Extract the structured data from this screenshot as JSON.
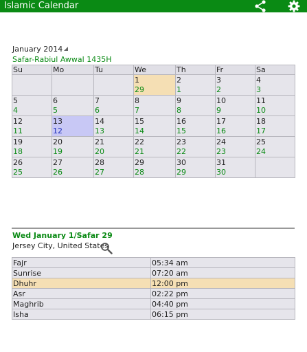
{
  "app": {
    "title": "Islamic Calendar",
    "share_icon": "share-icon",
    "settings_icon": "gear-icon",
    "bar_color": "#0a8a14"
  },
  "calendar": {
    "month_label": "January 2014",
    "hijri_label": "Safar-Rabiul Awwal 1435H",
    "weekdays": [
      "Su",
      "Mo",
      "Tu",
      "We",
      "Th",
      "Fr",
      "Sa"
    ],
    "weeks": [
      [
        null,
        null,
        null,
        {
          "g": "1",
          "h": "29",
          "state": "today"
        },
        {
          "g": "2",
          "h": "1"
        },
        {
          "g": "3",
          "h": "2"
        },
        {
          "g": "4",
          "h": "3"
        }
      ],
      [
        {
          "g": "5",
          "h": "4"
        },
        {
          "g": "6",
          "h": "5"
        },
        {
          "g": "7",
          "h": "6"
        },
        {
          "g": "8",
          "h": "7"
        },
        {
          "g": "9",
          "h": "8"
        },
        {
          "g": "10",
          "h": "9"
        },
        {
          "g": "11",
          "h": "10"
        }
      ],
      [
        {
          "g": "12",
          "h": "11"
        },
        {
          "g": "13",
          "h": "12",
          "state": "selected"
        },
        {
          "g": "14",
          "h": "13"
        },
        {
          "g": "15",
          "h": "14"
        },
        {
          "g": "16",
          "h": "15"
        },
        {
          "g": "17",
          "h": "16"
        },
        {
          "g": "18",
          "h": "17"
        }
      ],
      [
        {
          "g": "19",
          "h": "18"
        },
        {
          "g": "20",
          "h": "19"
        },
        {
          "g": "21",
          "h": "20"
        },
        {
          "g": "22",
          "h": "21"
        },
        {
          "g": "23",
          "h": "22"
        },
        {
          "g": "24",
          "h": "23"
        },
        {
          "g": "25",
          "h": "24"
        }
      ],
      [
        {
          "g": "26",
          "h": "25"
        },
        {
          "g": "27",
          "h": "26"
        },
        {
          "g": "28",
          "h": "27"
        },
        {
          "g": "29",
          "h": "28"
        },
        {
          "g": "30",
          "h": "29"
        },
        {
          "g": "31",
          "h": "30"
        },
        null
      ]
    ],
    "colors": {
      "today": "#f5dfb4",
      "selected": "#c8c8f5",
      "hijri_text": "#0a8a14"
    }
  },
  "details": {
    "selected_date": "Wed January 1/Safar 29",
    "location": "Jersey City, United States",
    "search_icon": "search-icon"
  },
  "prayers": [
    {
      "name": "Fajr",
      "time": "05:34 am"
    },
    {
      "name": "Sunrise",
      "time": "07:20 am"
    },
    {
      "name": "Dhuhr",
      "time": "12:00 pm",
      "current": true
    },
    {
      "name": "Asr",
      "time": "02:22 pm"
    },
    {
      "name": "Maghrib",
      "time": "04:40 pm"
    },
    {
      "name": "Isha",
      "time": "06:15 pm"
    }
  ]
}
